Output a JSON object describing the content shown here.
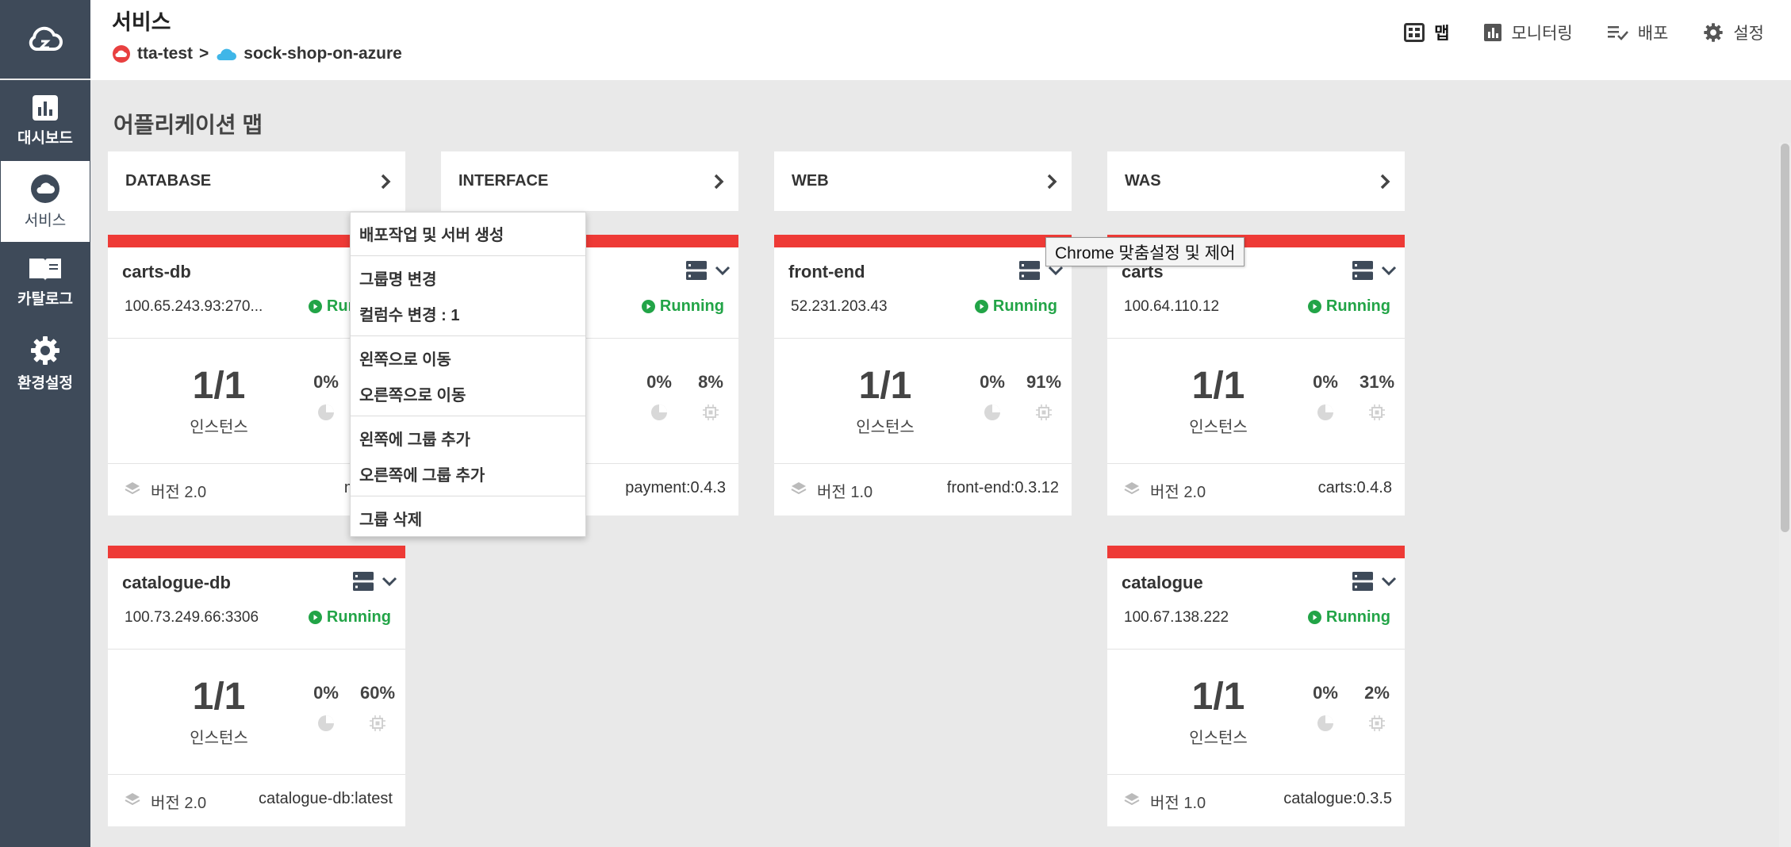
{
  "sidebar": {
    "items": [
      {
        "label": "대시보드",
        "icon": "bar-chart-icon"
      },
      {
        "label": "서비스",
        "icon": "cloud-icon"
      },
      {
        "label": "카탈로그",
        "icon": "book-icon"
      },
      {
        "label": "환경설정",
        "icon": "gear-icon"
      }
    ]
  },
  "header": {
    "title": "서비스",
    "breadcrumb_cluster": "tta-test",
    "breadcrumb_sep": ">",
    "breadcrumb_service": "sock-shop-on-azure",
    "nav": [
      {
        "label": "맵",
        "icon": "map-icon"
      },
      {
        "label": "모니터링",
        "icon": "chart-icon"
      },
      {
        "label": "배포",
        "icon": "deploy-list-icon"
      },
      {
        "label": "설정",
        "icon": "gear-icon"
      }
    ]
  },
  "main": {
    "section_title": "어플리케이션 맵",
    "groups": [
      {
        "name": "DATABASE"
      },
      {
        "name": "INTERFACE"
      },
      {
        "name": "WEB"
      },
      {
        "name": "WAS"
      }
    ],
    "cards": [
      {
        "name": "carts-db",
        "ip": "100.65.243.93:270...",
        "status": "Running",
        "instances": "1/1",
        "instances_label": "인스턴스",
        "cpu": "0%",
        "mem": "",
        "version": "버전 2.0",
        "image": "mongo"
      },
      {
        "name": "",
        "ip": "",
        "status": "Running",
        "instances": "",
        "instances_label": "",
        "cpu": "0%",
        "mem": "8%",
        "version": "",
        "image": "payment:0.4.3"
      },
      {
        "name": "front-end",
        "ip": "52.231.203.43",
        "status": "Running",
        "instances": "1/1",
        "instances_label": "인스턴스",
        "cpu": "0%",
        "mem": "91%",
        "version": "버전 1.0",
        "image": "front-end:0.3.12"
      },
      {
        "name": "carts",
        "ip": "100.64.110.12",
        "status": "Running",
        "instances": "1/1",
        "instances_label": "인스턴스",
        "cpu": "0%",
        "mem": "31%",
        "version": "버전 2.0",
        "image": "carts:0.4.8"
      },
      {
        "name": "catalogue-db",
        "ip": "100.73.249.66:3306",
        "status": "Running",
        "instances": "1/1",
        "instances_label": "인스턴스",
        "cpu": "0%",
        "mem": "60%",
        "version": "버전 2.0",
        "image": "catalogue-db:latest"
      },
      {
        "name": "catalogue",
        "ip": "100.67.138.222",
        "status": "Running",
        "instances": "1/1",
        "instances_label": "인스턴스",
        "cpu": "0%",
        "mem": "2%",
        "version": "버전 1.0",
        "image": "catalogue:0.3.5"
      }
    ]
  },
  "context_menu": {
    "items": [
      "배포작업 및 서버 생성",
      "그룹명 변경",
      "컬럼수 변경 : 1",
      "왼쪽으로 이동",
      "오른쪽으로 이동",
      "왼쪽에 그룹 추가",
      "오른쪽에 그룹 추가",
      "그룹 삭제"
    ]
  },
  "tooltip": "Chrome 맞춤설정 및 제어",
  "colors": {
    "sidebar": "#3e4a59",
    "card_accent": "#ee3a36",
    "running": "#22a447",
    "background": "#e9e9e9"
  }
}
